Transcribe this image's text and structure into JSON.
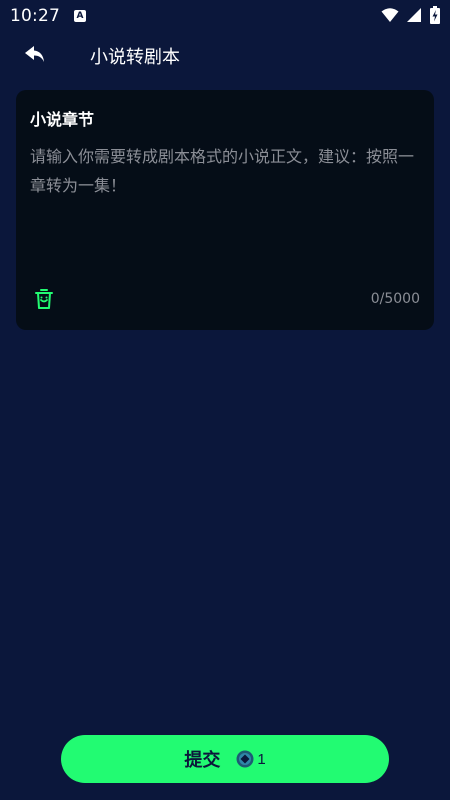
{
  "status_bar": {
    "time": "10:27",
    "notification_icon": "a-letter-icon",
    "icons": [
      "wifi-icon",
      "signal-icon",
      "battery-charging-icon"
    ]
  },
  "header": {
    "title": "小说转剧本",
    "back_icon": "back-arrow-icon"
  },
  "card": {
    "title": "小说章节",
    "placeholder": "请输入你需要转成剧本格式的小说正文，建议：按照一章转为一集！",
    "value": "",
    "counter": "0/5000",
    "delete_icon": "trash-icon"
  },
  "submit": {
    "label": "提交",
    "coin_icon": "coin-icon",
    "cost": "1"
  },
  "colors": {
    "background": "#0b173b",
    "card": "#050d17",
    "accent": "#22fb72",
    "placeholder": "#8b8e96"
  }
}
